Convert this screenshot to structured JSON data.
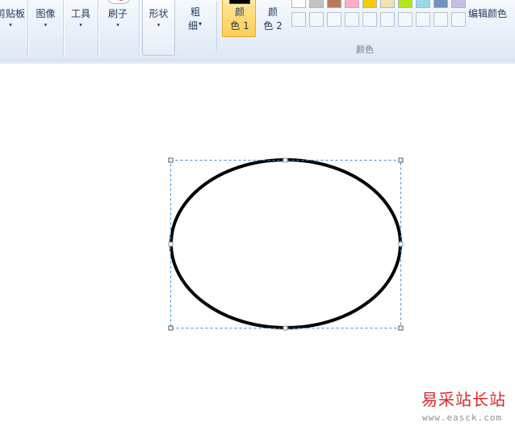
{
  "ribbon": {
    "clipboard": {
      "label": "剪贴板",
      "arrow": "▾"
    },
    "image": {
      "label": "图像",
      "arrow": "▾"
    },
    "tools": {
      "label": "工具",
      "arrow": "▾"
    },
    "brushes": {
      "label": "刷子",
      "arrow": "▾"
    },
    "shapes": {
      "label": "形状",
      "arrow": "▾"
    },
    "size": {
      "line1": "粗",
      "line2": "细",
      "arrow": "▾"
    },
    "color1": {
      "line1": "颜",
      "line2": "色 1",
      "color": "#000000"
    },
    "color2": {
      "line1": "颜",
      "line2": "色 2"
    },
    "palette": {
      "row1": [
        "#ffffff",
        "#c3c3c3",
        "#b97a57",
        "#ffaec9",
        "#ffc90e",
        "#efe4b0",
        "#b5e61d",
        "#99d9ea",
        "#7092be",
        "#c8bfe7"
      ],
      "row2_count": 10
    },
    "colors_group_label": "颜色",
    "edit_colors": "编辑颜色"
  },
  "watermark": {
    "title": "易采站长站",
    "url": "www.easck.com",
    "title_color": "#e0252b"
  }
}
